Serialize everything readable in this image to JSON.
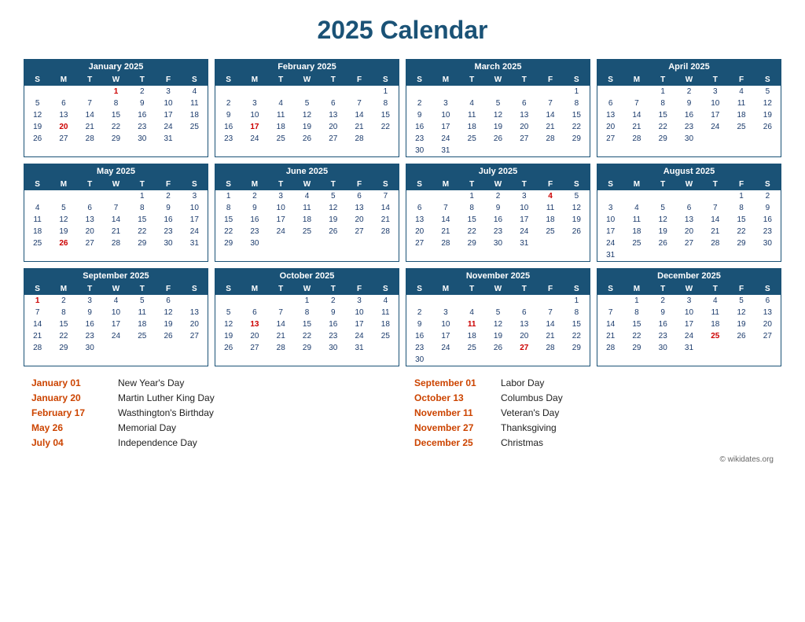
{
  "title": "2025 Calendar",
  "months": [
    {
      "name": "January 2025",
      "weeks": [
        [
          "",
          "",
          "",
          "1h",
          "2",
          "3",
          "4"
        ],
        [
          "5",
          "6",
          "7",
          "8",
          "9",
          "10",
          "11"
        ],
        [
          "12",
          "13",
          "14",
          "15",
          "16",
          "17",
          "18"
        ],
        [
          "19",
          "20h",
          "21",
          "22",
          "23",
          "24",
          "25"
        ],
        [
          "26",
          "27",
          "28",
          "29",
          "30",
          "31",
          ""
        ]
      ],
      "holidays": [
        1,
        20
      ]
    },
    {
      "name": "February 2025",
      "weeks": [
        [
          "",
          "",
          "",
          "",
          "",
          "",
          "1"
        ],
        [
          "2",
          "3",
          "4",
          "5",
          "6",
          "7",
          "8"
        ],
        [
          "9",
          "10",
          "11",
          "12",
          "13",
          "14",
          "15"
        ],
        [
          "16",
          "17h",
          "18",
          "19",
          "20",
          "21",
          "22"
        ],
        [
          "23",
          "24",
          "25",
          "26",
          "27",
          "28",
          ""
        ]
      ],
      "holidays": [
        17
      ]
    },
    {
      "name": "March 2025",
      "weeks": [
        [
          "",
          "",
          "",
          "",
          "",
          "",
          "1"
        ],
        [
          "2",
          "3",
          "4",
          "5",
          "6",
          "7",
          "8"
        ],
        [
          "9",
          "10",
          "11",
          "12",
          "13",
          "14",
          "15"
        ],
        [
          "16",
          "17",
          "18",
          "19",
          "20",
          "21",
          "22"
        ],
        [
          "23",
          "24",
          "25",
          "26",
          "27",
          "28",
          "29"
        ],
        [
          "30",
          "31",
          "",
          "",
          "",
          "",
          ""
        ]
      ],
      "holidays": []
    },
    {
      "name": "April 2025",
      "weeks": [
        [
          "",
          "",
          "1",
          "2",
          "3",
          "4",
          "5"
        ],
        [
          "6",
          "7",
          "8",
          "9",
          "10",
          "11",
          "12"
        ],
        [
          "13",
          "14",
          "15",
          "16",
          "17",
          "18",
          "19"
        ],
        [
          "20",
          "21",
          "22",
          "23",
          "24",
          "25",
          "26"
        ],
        [
          "27",
          "28",
          "29",
          "30",
          "",
          "",
          ""
        ]
      ],
      "holidays": []
    },
    {
      "name": "May 2025",
      "weeks": [
        [
          "",
          "",
          "",
          "",
          "1",
          "2",
          "3"
        ],
        [
          "4",
          "5",
          "6",
          "7",
          "8",
          "9",
          "10"
        ],
        [
          "11",
          "12",
          "13",
          "14",
          "15",
          "16",
          "17"
        ],
        [
          "18",
          "19",
          "20",
          "21",
          "22",
          "23",
          "24"
        ],
        [
          "25",
          "26h",
          "27",
          "28",
          "29",
          "30",
          "31"
        ]
      ],
      "holidays": [
        26
      ]
    },
    {
      "name": "June 2025",
      "weeks": [
        [
          "1",
          "2",
          "3",
          "4",
          "5",
          "6",
          "7"
        ],
        [
          "8",
          "9",
          "10",
          "11",
          "12",
          "13",
          "14"
        ],
        [
          "15",
          "16",
          "17",
          "18",
          "19",
          "20",
          "21"
        ],
        [
          "22",
          "23",
          "24",
          "25",
          "26",
          "27",
          "28"
        ],
        [
          "29",
          "30",
          "",
          "",
          "",
          "",
          ""
        ]
      ],
      "holidays": []
    },
    {
      "name": "July 2025",
      "weeks": [
        [
          "",
          "",
          "1",
          "2",
          "3",
          "4h",
          "5"
        ],
        [
          "6",
          "7",
          "8",
          "9",
          "10",
          "11",
          "12"
        ],
        [
          "13",
          "14",
          "15",
          "16",
          "17",
          "18",
          "19"
        ],
        [
          "20",
          "21",
          "22",
          "23",
          "24",
          "25",
          "26"
        ],
        [
          "27",
          "28",
          "29",
          "30",
          "31",
          "",
          ""
        ]
      ],
      "holidays": [
        4
      ]
    },
    {
      "name": "August 2025",
      "weeks": [
        [
          "",
          "",
          "",
          "",
          "",
          "1",
          "2"
        ],
        [
          "3",
          "4",
          "5",
          "6",
          "7",
          "8",
          "9"
        ],
        [
          "10",
          "11",
          "12",
          "13",
          "14",
          "15",
          "16"
        ],
        [
          "17",
          "18",
          "19",
          "20",
          "21",
          "22",
          "23"
        ],
        [
          "24",
          "25",
          "26",
          "27",
          "28",
          "29",
          "30"
        ],
        [
          "31",
          "",
          "",
          "",
          "",
          "",
          ""
        ]
      ],
      "holidays": []
    },
    {
      "name": "September 2025",
      "weeks": [
        [
          "1h",
          "2",
          "3",
          "4",
          "5",
          "6",
          ""
        ],
        [
          "7",
          "8",
          "9",
          "10",
          "11",
          "12",
          "13"
        ],
        [
          "14",
          "15",
          "16",
          "17",
          "18",
          "19",
          "20"
        ],
        [
          "21",
          "22",
          "23",
          "24",
          "25",
          "26",
          "27"
        ],
        [
          "28",
          "29",
          "30",
          "",
          "",
          "",
          ""
        ]
      ],
      "holidays": [
        1
      ]
    },
    {
      "name": "October 2025",
      "weeks": [
        [
          "",
          "",
          "",
          "1",
          "2",
          "3",
          "4"
        ],
        [
          "5",
          "6",
          "7",
          "8",
          "9",
          "10",
          "11"
        ],
        [
          "12",
          "13h",
          "14",
          "15",
          "16",
          "17",
          "18"
        ],
        [
          "19",
          "20",
          "21",
          "22",
          "23",
          "24",
          "25"
        ],
        [
          "26",
          "27",
          "28",
          "29",
          "30",
          "31",
          ""
        ]
      ],
      "holidays": [
        13
      ]
    },
    {
      "name": "November 2025",
      "weeks": [
        [
          "",
          "",
          "",
          "",
          "",
          "",
          "1"
        ],
        [
          "2",
          "3",
          "4",
          "5",
          "6",
          "7",
          "8"
        ],
        [
          "9",
          "10",
          "11h",
          "12",
          "13",
          "14",
          "15"
        ],
        [
          "16",
          "17",
          "18",
          "19",
          "20",
          "21",
          "22"
        ],
        [
          "23",
          "24",
          "25",
          "26",
          "27h",
          "28",
          "29"
        ],
        [
          "30",
          "",
          "",
          "",
          "",
          "",
          ""
        ]
      ],
      "holidays": [
        11,
        27
      ]
    },
    {
      "name": "December 2025",
      "weeks": [
        [
          "",
          "1",
          "2",
          "3",
          "4",
          "5",
          "6"
        ],
        [
          "7",
          "8",
          "9",
          "10",
          "11",
          "12",
          "13"
        ],
        [
          "14",
          "15",
          "16",
          "17",
          "18",
          "19",
          "20"
        ],
        [
          "21",
          "22",
          "23",
          "24",
          "25h",
          "26",
          "27"
        ],
        [
          "28",
          "29",
          "30",
          "31",
          "",
          "",
          ""
        ]
      ],
      "holidays": [
        25
      ]
    }
  ],
  "holidays_list": [
    {
      "date": "January 01",
      "name": "New Year's Day"
    },
    {
      "date": "January 20",
      "name": "Martin Luther King Day"
    },
    {
      "date": "February 17",
      "name": "Wasthington's Birthday"
    },
    {
      "date": "May 26",
      "name": "Memorial Day"
    },
    {
      "date": "July 04",
      "name": "Independence Day"
    },
    {
      "date": "September 01",
      "name": "Labor Day"
    },
    {
      "date": "October 13",
      "name": "Columbus Day"
    },
    {
      "date": "November 11",
      "name": "Veteran's Day"
    },
    {
      "date": "November 27",
      "name": "Thanksgiving"
    },
    {
      "date": "December 25",
      "name": "Christmas"
    }
  ],
  "copyright": "© wikidates.org",
  "days_header": [
    "S",
    "M",
    "T",
    "W",
    "T",
    "F",
    "S"
  ]
}
